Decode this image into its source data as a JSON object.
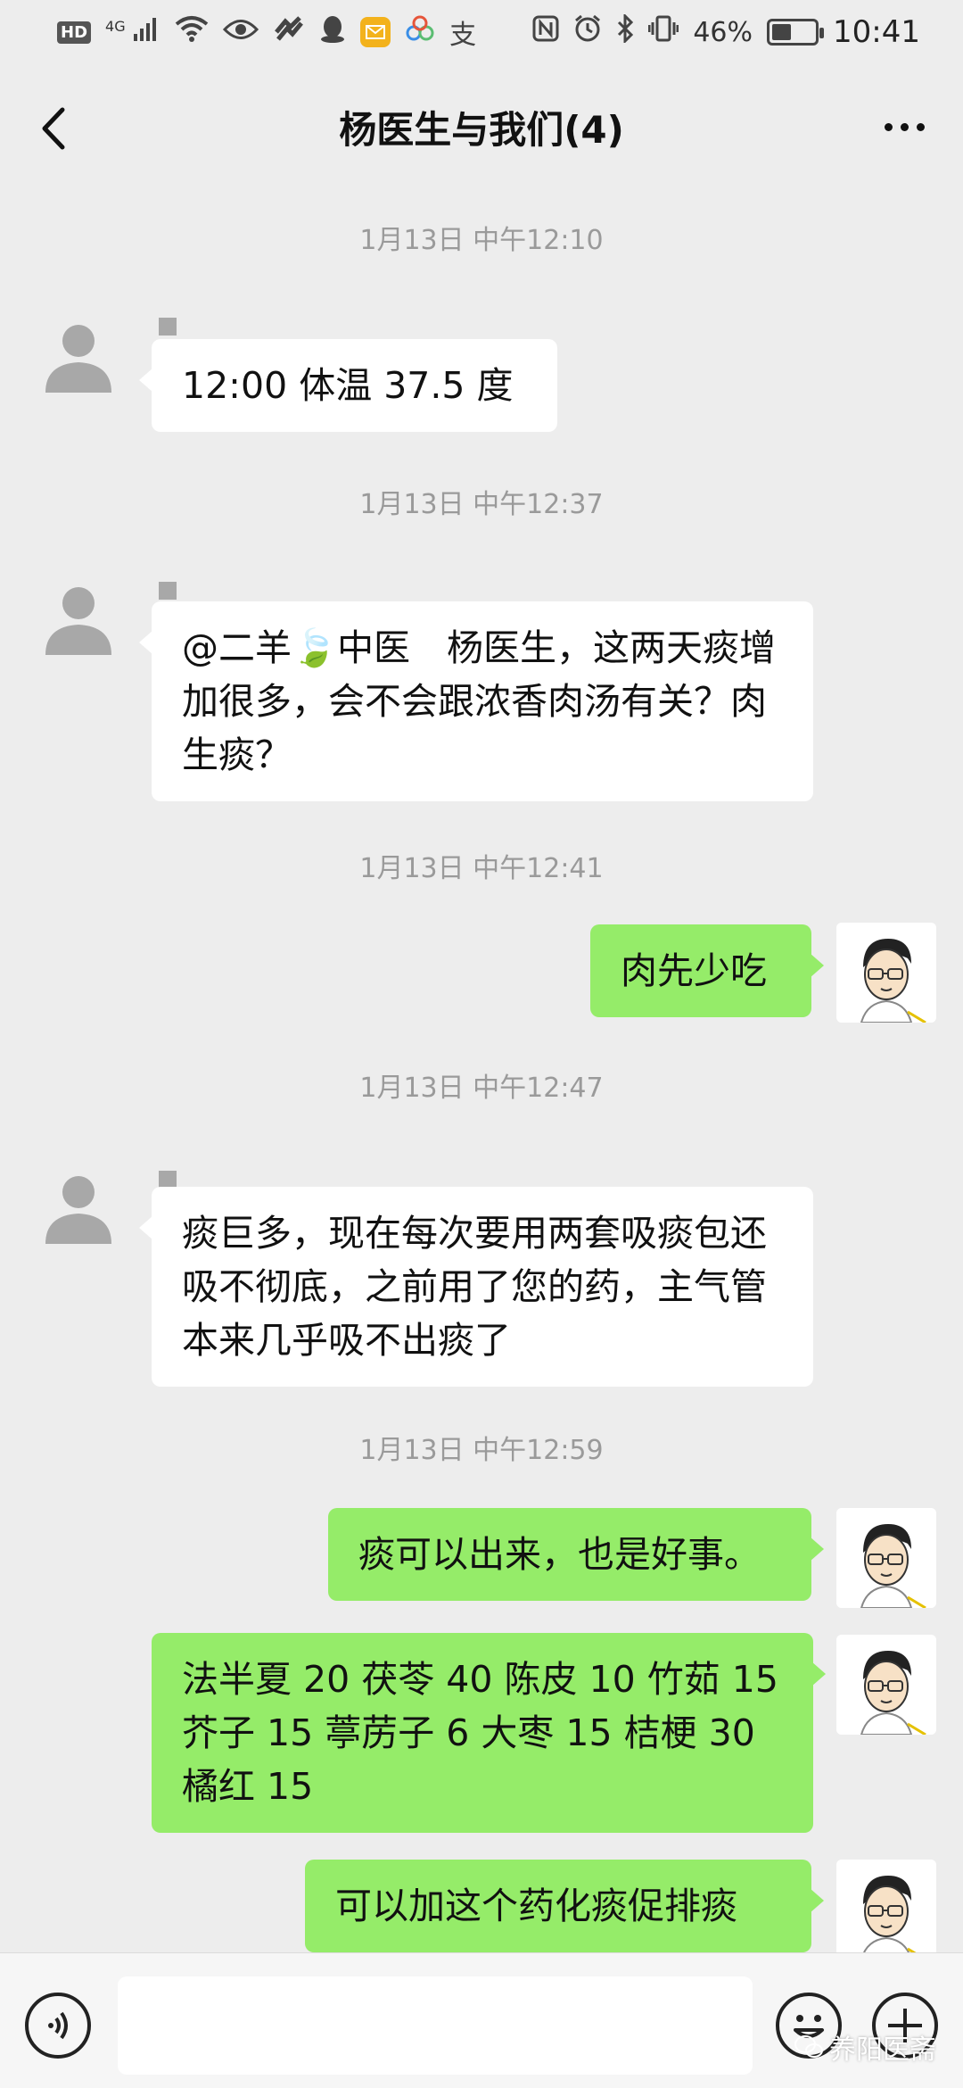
{
  "status_bar": {
    "hd": "HD",
    "network": "4G",
    "pay_glyph": "支",
    "battery_label": "46%",
    "battery_level": 0.46,
    "time": "10:41"
  },
  "header": {
    "title": "杨医生与我们(4)"
  },
  "messages": [
    {
      "type": "time",
      "text": "1月13日 中午12:10"
    },
    {
      "type": "in",
      "text": "12:00 体温 37.5 度"
    },
    {
      "type": "time",
      "text": "1月13日 中午12:37"
    },
    {
      "type": "in",
      "text_a": "@二羊",
      "emoji": "🍃",
      "text_b": "中医　杨医生，这两天痰增加很多，会不会跟浓香肉汤有关？肉生痰？"
    },
    {
      "type": "time",
      "text": "1月13日 中午12:41"
    },
    {
      "type": "out",
      "text": "肉先少吃"
    },
    {
      "type": "time",
      "text": "1月13日 中午12:47"
    },
    {
      "type": "in",
      "text": "痰巨多，现在每次要用两套吸痰包还吸不彻底，之前用了您的药，主气管本来几乎吸不出痰了"
    },
    {
      "type": "time",
      "text": "1月13日 中午12:59"
    },
    {
      "type": "out",
      "text": "痰可以出来，也是好事。"
    },
    {
      "type": "out",
      "text": "法半夏 20 茯苓 40 陈皮 10 竹茹 15芥子 15 葶苈子 6 大枣 15 桔梗 30橘红 15"
    },
    {
      "type": "out",
      "text": "可以加这个药化痰促排痰"
    }
  ],
  "watermark": "养阳医斋",
  "colors": {
    "background": "#ededed",
    "bubble_out": "#95ec69",
    "bubble_in": "#ffffff",
    "timestamp": "#9a9a9a"
  },
  "icons": [
    "back-arrow-icon",
    "more-dots-icon",
    "voice-icon",
    "emoji-icon",
    "plus-icon",
    "default-avatar-icon",
    "doctor-avatar-icon"
  ]
}
